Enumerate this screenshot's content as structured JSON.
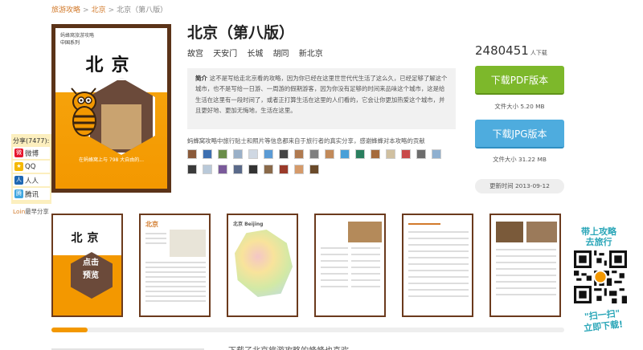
{
  "breadcrumb": {
    "item1": "旅游攻略",
    "sep": ">",
    "item2": "北京",
    "current": "北京（第八版）"
  },
  "cover": {
    "publisher": "蚂蜂窝旅游攻略",
    "series": "中国系列",
    "title": "北京",
    "tagline": "在蚂蜂窝上与 798 大自由的..."
  },
  "book": {
    "title": "北京（第八版）",
    "tags": [
      "故宫",
      "天安门",
      "长城",
      "胡同",
      "新北京"
    ],
    "summary_label": "简介",
    "summary": "这不是写给走北京看的攻略，因为你已经在这里世世代代生活了这么久，已经足够了解这个城市，也不是写给一日游、一周游的假期游客，因为你没有足够的时间来品味这个城市，这是给生活在这里有一段时间了，或者正打算生活在这里的人们看的，它会让你更加热爱这个城市，并且更好地、更加无悔地，生活在这里。",
    "contributors_text": "蚂蜂窝攻略中旅行贴士和照片等信息都来自于旅行者的真实分享，感谢蜂蜂对本攻略的贡献"
  },
  "downloads": {
    "count": "2480451",
    "unit": "人下载"
  },
  "pdf": {
    "button_label": "下载PDF版本",
    "size": "文件大小 5.20 MB"
  },
  "jpg": {
    "button_label": "下载JPG版本",
    "size": "文件大小 31.22 MB"
  },
  "update": {
    "label": "更新时间 2013-09-12"
  },
  "share": {
    "title": "分享(7477):",
    "items": [
      {
        "label": "微博",
        "icon": "weibo-icon",
        "color": "#e6162d"
      },
      {
        "label": "QQ",
        "icon": "qzone-icon",
        "color": "#f5b800"
      },
      {
        "label": "人人",
        "icon": "renren-icon",
        "color": "#1f68b3"
      },
      {
        "label": "腾讯",
        "icon": "tencent-weibo-icon",
        "color": "#3fa6e0"
      }
    ]
  },
  "login_note": {
    "link": "Loin",
    "text": "最早分享"
  },
  "thumbnails": {
    "first_title": "北京",
    "preview_label_1": "点击",
    "preview_label_2": "预览",
    "page2_title": "北京",
    "page3_title": "北京 Beijing"
  },
  "progress": {
    "value_percent": 7
  },
  "bottom": {
    "text": "下载了北京旅游攻略的蜂蜂也喜欢"
  },
  "promo": {
    "line1": "带上攻略",
    "line2": "去旅行",
    "line3": "\"扫一扫\"",
    "line4": "立即下载!"
  },
  "colors": {
    "accent": "#f39800",
    "pdf_button": "#7db82b",
    "jpg_button": "#4eacde",
    "cover_frame": "#5b3318"
  }
}
